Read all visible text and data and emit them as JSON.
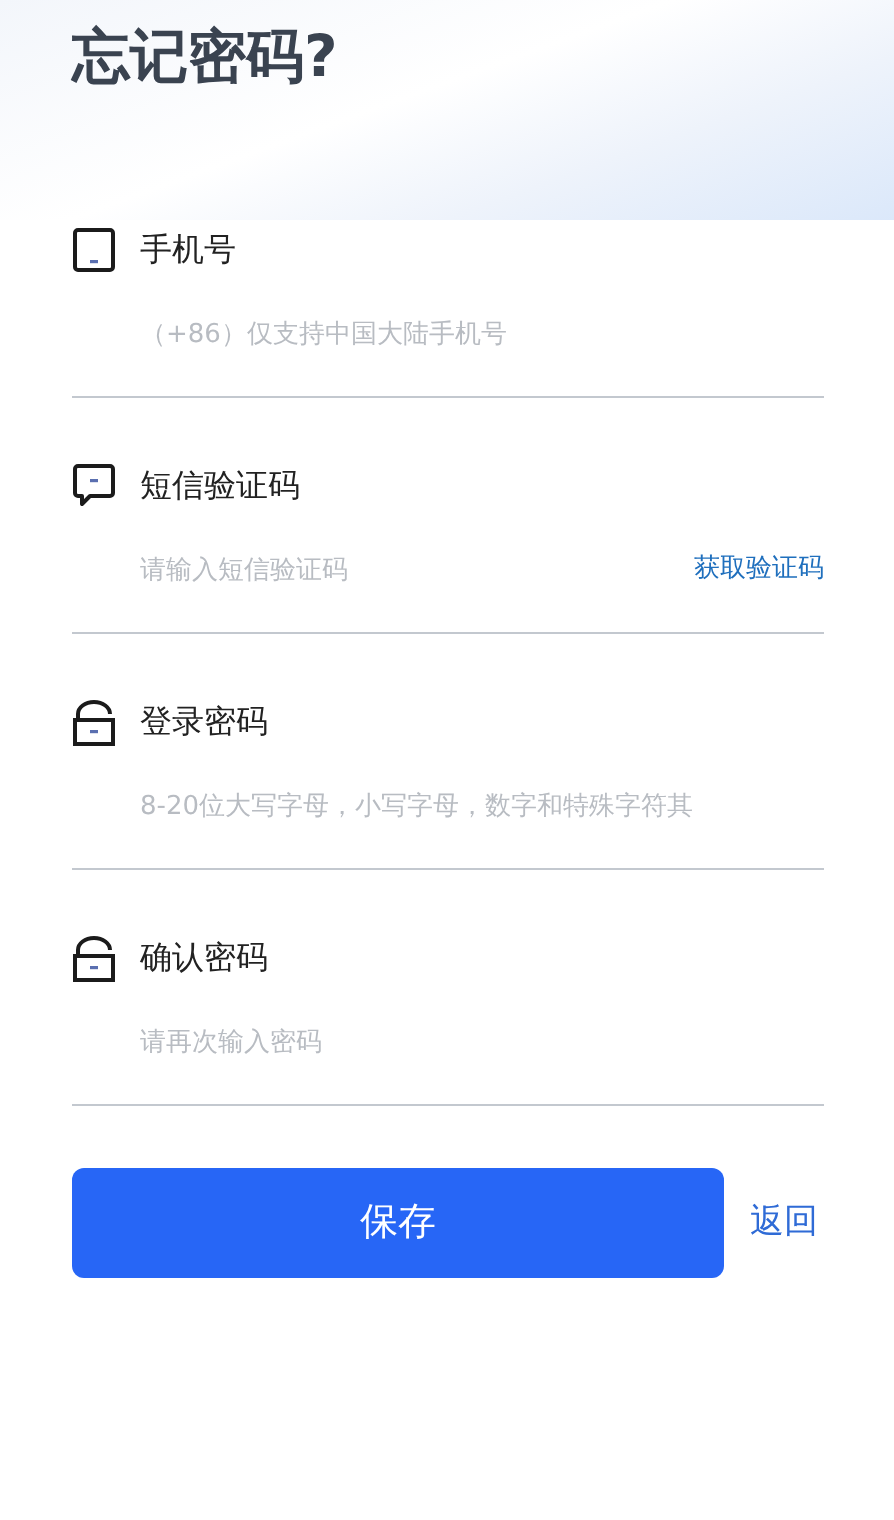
{
  "title": "忘记密码?",
  "fields": [
    {
      "kind": "phone",
      "label": "手机号",
      "placeholder": "（+86）仅支持中国大陆手机号"
    },
    {
      "kind": "message",
      "label": "短信验证码",
      "placeholder": "请输入短信验证码",
      "action": "获取验证码"
    },
    {
      "kind": "lock",
      "label": "登录密码",
      "placeholder": "8-20位大写字母，小写字母，数字和特殊字符其"
    },
    {
      "kind": "lock",
      "label": "确认密码",
      "placeholder": "请再次输入密码"
    }
  ],
  "save_button": "保存",
  "back_link": "返回"
}
